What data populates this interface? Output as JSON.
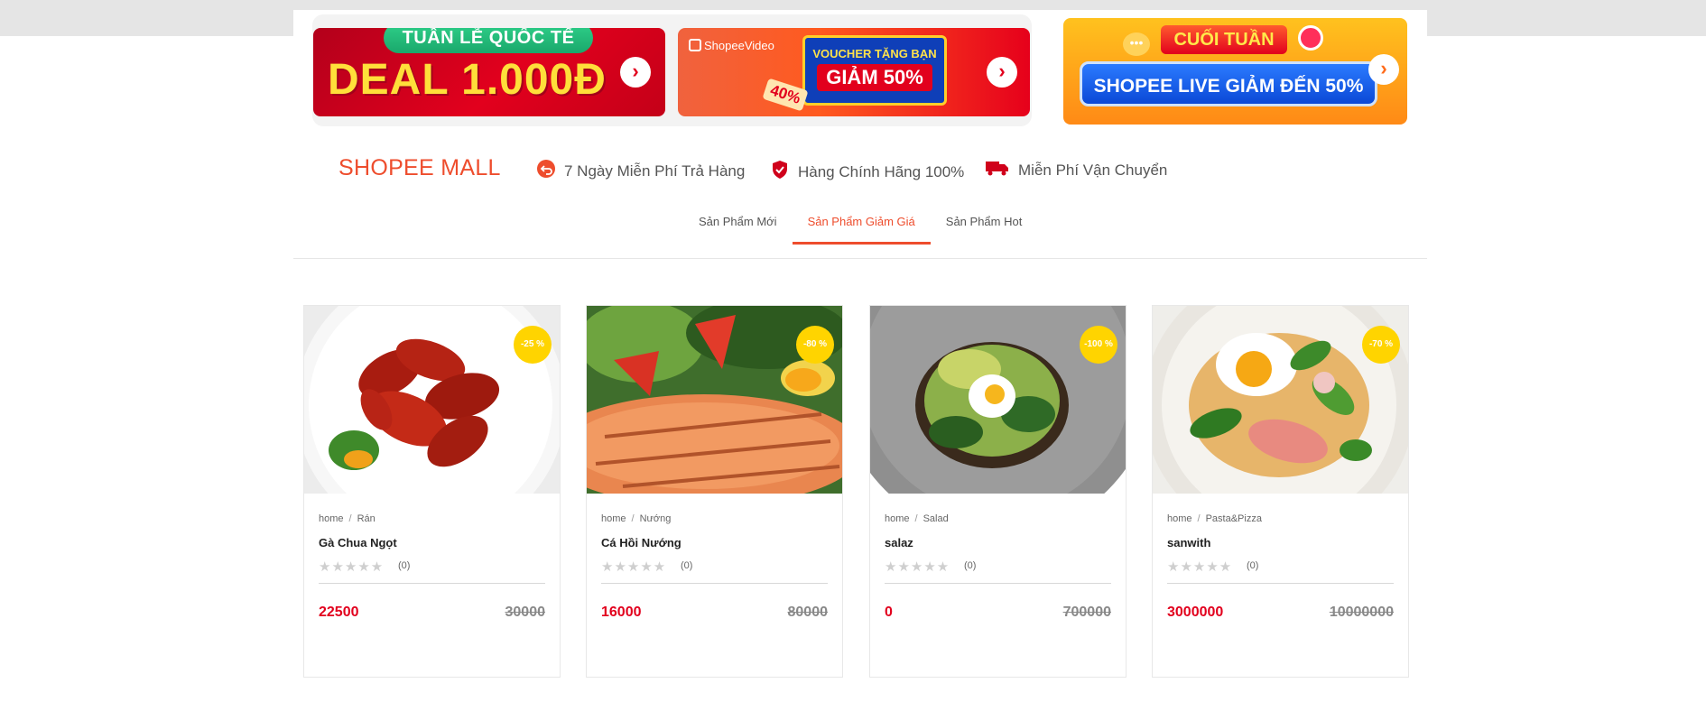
{
  "banners": [
    {
      "pill": "TUẦN LỄ QUỐC TẾ",
      "main": "DEAL 1.000Đ",
      "arrow": "arrow-right-icon"
    },
    {
      "brand": "ShopeeVideo",
      "line1": "VOUCHER TẶNG BẠN",
      "line2": "GIẢM 50%",
      "badge": "40%",
      "arrow": "arrow-right-icon"
    },
    {
      "top": "CUỐI TUẦN",
      "main": "SHOPEE LIVE GIẢM ĐẾN 50%",
      "arrow": "arrow-right-icon"
    }
  ],
  "mall": {
    "title": "SHOPEE MALL",
    "features": [
      {
        "label": "7 Ngày Miễn Phí Trả Hàng",
        "icon": "return-icon"
      },
      {
        "label": "Hàng Chính Hãng 100%",
        "icon": "shield-check-icon"
      },
      {
        "label": "Miễn Phí Vận Chuyển",
        "icon": "truck-icon"
      }
    ]
  },
  "tabs": [
    "Sản Phẩm Mới",
    "Sản Phẩm Giảm Giá",
    "Sản Phẩm Hot"
  ],
  "active_tab": 1,
  "products": [
    {
      "crumb_home": "home",
      "category": "Rán",
      "name": "Gà Chua Ngọt",
      "discount": "-25 %",
      "reviews": "(0)",
      "price": "22500",
      "old_price": "30000"
    },
    {
      "crumb_home": "home",
      "category": "Nướng",
      "name": "Cá Hồi Nướng",
      "discount": "-80 %",
      "reviews": "(0)",
      "price": "16000",
      "old_price": "80000"
    },
    {
      "crumb_home": "home",
      "category": "Salad",
      "name": "salaz",
      "discount": "-100 %",
      "reviews": "(0)",
      "price": "0",
      "old_price": "700000"
    },
    {
      "crumb_home": "home",
      "category": "Pasta&Pizza",
      "name": "sanwith",
      "discount": "-70 %",
      "reviews": "(0)",
      "price": "3000000",
      "old_price": "10000000"
    }
  ],
  "colors": {
    "brand": "#ee4d2d",
    "price": "#e2001d",
    "badge": "#ffd400"
  }
}
